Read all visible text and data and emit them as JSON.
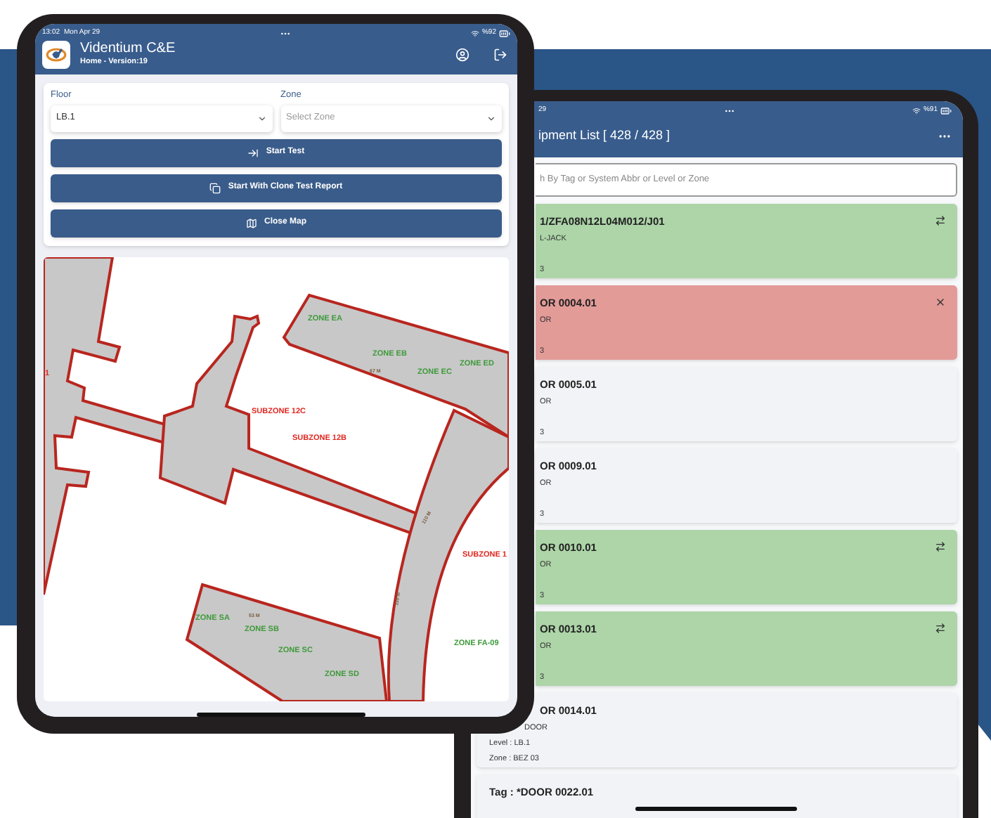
{
  "left_tablet": {
    "status_bar": {
      "time": "13:02",
      "date": "Mon Apr 29",
      "battery": "%92"
    },
    "header": {
      "title": "Videntium C&E",
      "subtitle": "Home - Version:19"
    },
    "filters": [
      {
        "label": "Floor",
        "value": "LB.1"
      },
      {
        "label": "Zone",
        "placeholder": "Select Zone"
      }
    ],
    "buttons": [
      {
        "label": "Start Test",
        "kind": "start"
      },
      {
        "label": "Start With Clone Test Report",
        "kind": "clone"
      },
      {
        "label": "Close Map",
        "kind": "map"
      }
    ],
    "map": {
      "labels": [
        {
          "text": "ZONE EA",
          "kind": "zone"
        },
        {
          "text": "ZONE EB",
          "kind": "zone"
        },
        {
          "text": "ZONE EC",
          "kind": "zone"
        },
        {
          "text": "ZONE ED",
          "kind": "zone"
        },
        {
          "text": "1",
          "kind": "subzone"
        },
        {
          "text": "SUBZONE 12C",
          "kind": "subzone"
        },
        {
          "text": "SUBZONE 12B",
          "kind": "subzone"
        },
        {
          "text": "SUBZONE 1",
          "kind": "subzone"
        },
        {
          "text": "ZONE SA",
          "kind": "zone"
        },
        {
          "text": "ZONE SB",
          "kind": "zone"
        },
        {
          "text": "ZONE SC",
          "kind": "zone"
        },
        {
          "text": "ZONE SD",
          "kind": "zone"
        },
        {
          "text": "ZONE FA-09",
          "kind": "zone"
        },
        {
          "text": "67 M",
          "kind": "measure"
        },
        {
          "text": "53 M",
          "kind": "measure"
        },
        {
          "text": "110 M",
          "kind": "measure"
        },
        {
          "text": "110 M",
          "kind": "measure"
        }
      ]
    }
  },
  "right_tablet": {
    "status_bar": {
      "date": "29",
      "battery": "%91"
    },
    "header": {
      "title": "ipment List [ 428 / 428 ]"
    },
    "search": {
      "placeholder": "h By Tag or System Abbr or Level or Zone"
    },
    "cards": [
      {
        "title": "1/ZFA08N12L04M012/J01",
        "type": "L-JACK",
        "zone": "3",
        "color": "#add5a8",
        "kind": "swap"
      },
      {
        "title": "OR 0004.01",
        "type": "OR",
        "zone": "3",
        "color": "#e39b98",
        "kind": "cross"
      },
      {
        "title": "OR 0005.01",
        "type": "OR",
        "zone": "3",
        "color": "#f2f3f7",
        "kind": "plain"
      },
      {
        "title": "OR 0009.01",
        "type": "OR",
        "zone": "3",
        "color": "#f2f3f7",
        "kind": "plain"
      },
      {
        "title": "OR 0010.01",
        "type": "OR",
        "zone": "3",
        "color": "#add5a8",
        "kind": "swap"
      },
      {
        "title": "OR 0013.01",
        "type": "OR",
        "zone": "3",
        "color": "#add5a8",
        "kind": "swap"
      },
      {
        "title": "OR 0014.01",
        "type": "DOOR",
        "level": "Level : LB.1",
        "zone": "Zone : BEZ 03",
        "color": "#f2f3f7",
        "kind": "plain"
      },
      {
        "title": "Tag : *DOOR 0022.01",
        "color": "#f2f3f7",
        "kind": "plain"
      }
    ]
  }
}
